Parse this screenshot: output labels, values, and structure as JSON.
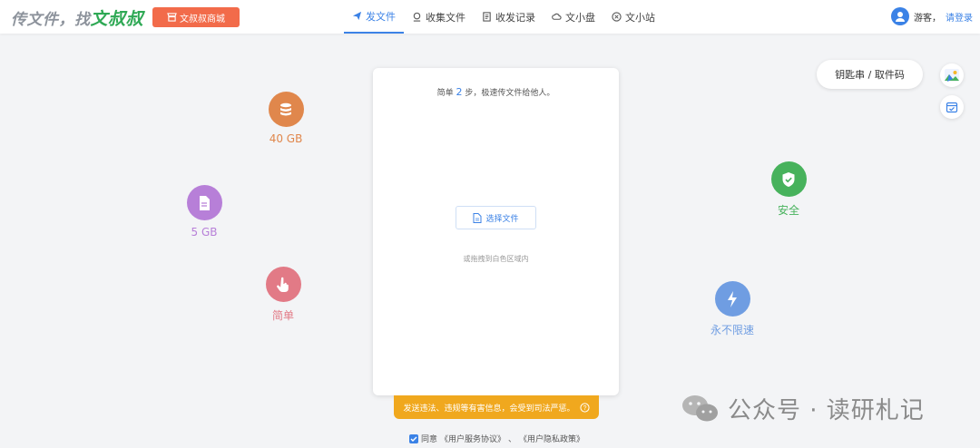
{
  "header": {
    "logo_prefix": "传文件，找",
    "logo_brand": "文叔叔",
    "shop_button": "文叔叔商城",
    "nav": [
      {
        "label": "发文件",
        "icon": "paper-plane-icon",
        "active": true
      },
      {
        "label": "收集文件",
        "icon": "collect-icon",
        "active": false
      },
      {
        "label": "收发记录",
        "icon": "record-icon",
        "active": false
      },
      {
        "label": "文小盘",
        "icon": "cloud-disk-icon",
        "active": false
      },
      {
        "label": "文小站",
        "icon": "site-icon",
        "active": false
      }
    ],
    "guest_label": "游客，",
    "login_link": "请登录"
  },
  "features": {
    "storage": {
      "label": "40 GB",
      "color": "#e0874c",
      "icon": "database-icon"
    },
    "file_size": {
      "label": "5 GB",
      "color": "#b77fd8",
      "icon": "document-icon"
    },
    "simple": {
      "label": "简单",
      "color": "#e27a86",
      "icon": "hand-pointer-icon"
    },
    "safe": {
      "label": "安全",
      "color": "#47b25c",
      "icon": "shield-icon"
    },
    "speed": {
      "label": "永不限速",
      "color": "#6f9de2",
      "icon": "lightning-icon"
    }
  },
  "upload": {
    "title_prefix": "简单",
    "title_num": "2",
    "title_suffix": "步，极速传文件给他人。",
    "choose_button": "选择文件",
    "drop_hint": "或拖拽到白色区域内"
  },
  "warning_text": "发送违法、违规等有害信息，会受到司法严惩。",
  "agree": {
    "prefix": "同意",
    "terms": "《用户服务协议》",
    "separator": "、",
    "privacy": "《用户隐私政策》"
  },
  "key_button": "钥匙串 / 取件码",
  "watermark": "公众号 · 读研札记"
}
